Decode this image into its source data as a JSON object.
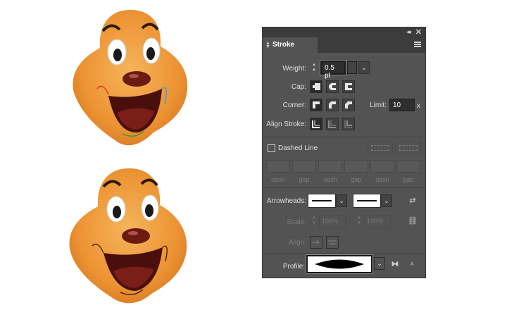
{
  "panel": {
    "tab_label": "Stroke",
    "weight": {
      "label": "Weight:",
      "value": "0.5 pt"
    },
    "cap": {
      "label": "Cap:",
      "selected": "butt"
    },
    "corner": {
      "label": "Corner:",
      "selected": "miter"
    },
    "limit": {
      "label": "Limit:",
      "value": "10",
      "unit": "x"
    },
    "align_stroke": {
      "label": "Align Stroke:",
      "selected": "center"
    },
    "dashed_line": {
      "label": "Dashed Line",
      "checked": false
    },
    "dash_gap_labels": [
      "dash",
      "gap",
      "dash",
      "gap",
      "dash",
      "gap"
    ],
    "arrowheads": {
      "label": "Arrowheads:"
    },
    "scale": {
      "label": "Scale:",
      "start": "100%",
      "end": "100%"
    },
    "align": {
      "label": "Align:"
    },
    "profile": {
      "label": "Profile:"
    }
  },
  "colors": {
    "panel_bg": "#535353",
    "face": "#ef9a3a",
    "mouth": "#4a0f0c",
    "nose": "#6b1b12"
  },
  "icons": [
    "double-chevron-left-icon",
    "close-icon",
    "updown-icon",
    "panel-menu-icon",
    "swap-arrowheads-icon",
    "link-icon",
    "flip-horizontal-icon",
    "flip-vertical-icon"
  ]
}
